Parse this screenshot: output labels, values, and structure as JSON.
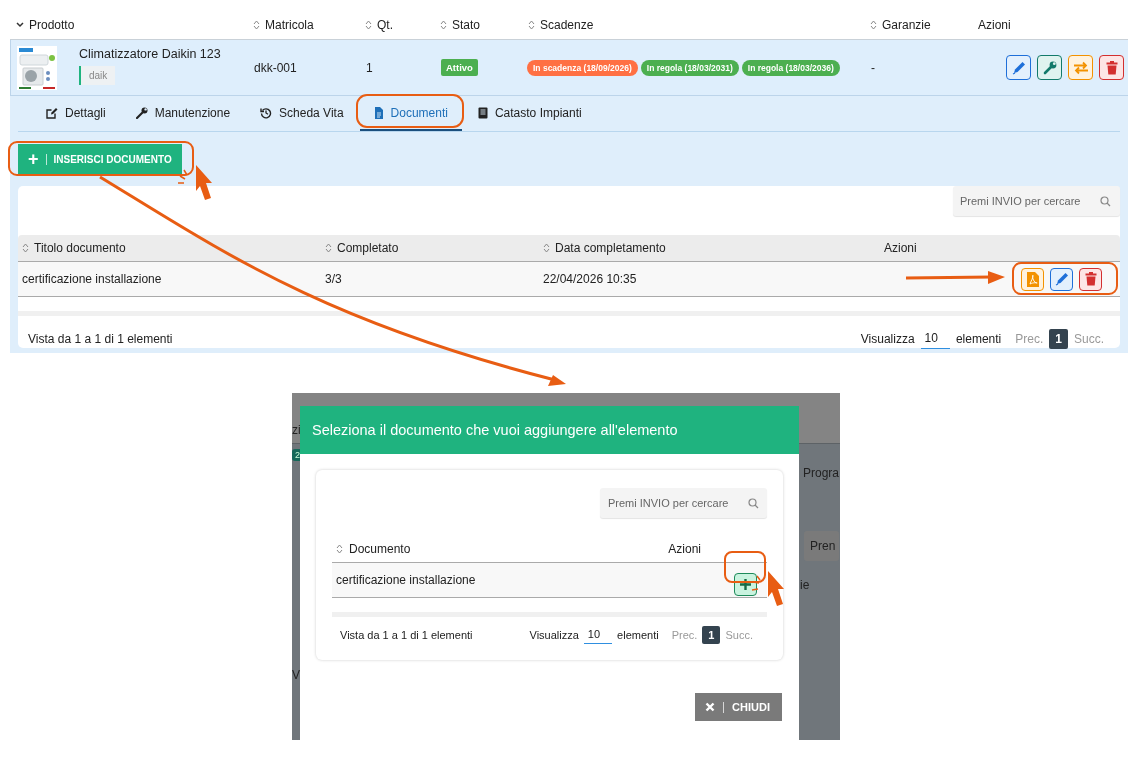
{
  "product_table": {
    "columns": [
      {
        "label": "Prodotto",
        "kind": "expand"
      },
      {
        "label": "Matricola",
        "kind": "sort"
      },
      {
        "label": "Qt.",
        "kind": "sort"
      },
      {
        "label": "Stato",
        "kind": "sort"
      },
      {
        "label": "Scadenze",
        "kind": "sort"
      },
      {
        "label": "Garanzie",
        "kind": "sort"
      },
      {
        "label": "Azioni",
        "kind": "plain"
      }
    ],
    "rows": [
      {
        "name": "Climatizzatore Daikin 123",
        "image": {
          "kind": "picture"
        },
        "tag": "daik",
        "serial": "dkk-001",
        "qty": "1",
        "status": {
          "label": "Attivo",
          "color": "#4caf50"
        },
        "deadlines": [
          {
            "label": "In scadenza (18/09/2026)",
            "color": "#ff7043"
          },
          {
            "label": "In regola (18/03/2031)",
            "color": "#4caf50"
          },
          {
            "label": "In regola (18/03/2036)",
            "color": "#4caf50"
          }
        ],
        "warranty": "-",
        "actions": [
          {
            "kind": "edit"
          },
          {
            "kind": "maintenance"
          },
          {
            "kind": "transfer"
          },
          {
            "kind": "delete"
          }
        ]
      }
    ]
  },
  "detail_tabs": [
    {
      "label": "Dettagli",
      "kind": "edit",
      "selected": false
    },
    {
      "label": "Manutenzione",
      "kind": "wrench",
      "selected": false
    },
    {
      "label": "Scheda Vita",
      "kind": "history",
      "selected": false
    },
    {
      "label": "Documenti",
      "kind": "file",
      "selected": true
    },
    {
      "label": "Catasto Impianti",
      "kind": "book",
      "selected": false
    }
  ],
  "insert_button": {
    "icon": "+",
    "label": "INSERISCI DOCUMENTO"
  },
  "documents": {
    "search": {
      "placeholder": "Premi INVIO per cercare"
    },
    "columns": [
      {
        "label": "Titolo documento",
        "kind": "sort"
      },
      {
        "label": "Completato",
        "kind": "sort"
      },
      {
        "label": "Data completamento",
        "kind": "sort"
      },
      {
        "label": "Azioni",
        "kind": "plain"
      }
    ],
    "rows": [
      {
        "title": "certificazione installazione",
        "completed": "3/3",
        "date": "22/04/2026 10:35",
        "actions": [
          {
            "kind": "pdf"
          },
          {
            "kind": "edit"
          },
          {
            "kind": "delete"
          }
        ]
      }
    ],
    "footer": {
      "info": "Vista da 1 a 1 di 1 elementi",
      "show_label": "Visualizza",
      "page_size": "10",
      "unit": "elementi",
      "prev": "Prec.",
      "pages": [
        {
          "label": "1",
          "selected": true
        }
      ],
      "next": "Succ."
    }
  },
  "background_fragments": [
    {
      "text": "zi",
      "kind": "text"
    },
    {
      "text": "2",
      "kind": "badge"
    },
    {
      "text": "Progra",
      "kind": "text"
    },
    {
      "text": "Pren",
      "kind": "field"
    },
    {
      "text": "ie",
      "kind": "text"
    },
    {
      "text": "V",
      "kind": "text"
    }
  ],
  "modal": {
    "title": "Seleziona il documento che vuoi aggiungere all'elemento",
    "search": {
      "placeholder": "Premi INVIO per cercare"
    },
    "columns": [
      {
        "label": "Documento",
        "kind": "sort"
      },
      {
        "label": "Azioni",
        "kind": "plain"
      }
    ],
    "rows": [
      {
        "title": "certificazione installazione",
        "actions": [
          {
            "kind": "add"
          }
        ]
      }
    ],
    "footer": {
      "info": "Vista da 1 a 1 di 1 elementi",
      "show_label": "Visualizza",
      "page_size": "10",
      "unit": "elementi",
      "prev": "Prec.",
      "pages": [
        {
          "label": "1",
          "selected": true
        }
      ],
      "next": "Succ."
    },
    "close_button": {
      "label": "CHIUDI"
    }
  }
}
